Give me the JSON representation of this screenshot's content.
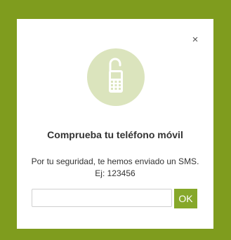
{
  "colors": {
    "background": "#7f9c1e",
    "icon_circle": "#dbe4bd",
    "icon_fg": "#ffffff",
    "ok_button": "#86a82a"
  },
  "modal": {
    "close_label": "×",
    "icon": "unlocked-phone-icon",
    "title": "Comprueba tu teléfono móvil",
    "message_line1": "Por tu seguridad, te hemos enviado un SMS.",
    "message_line2": "Ej: 123456",
    "input": {
      "value": "",
      "placeholder": ""
    },
    "ok_label": "OK"
  }
}
